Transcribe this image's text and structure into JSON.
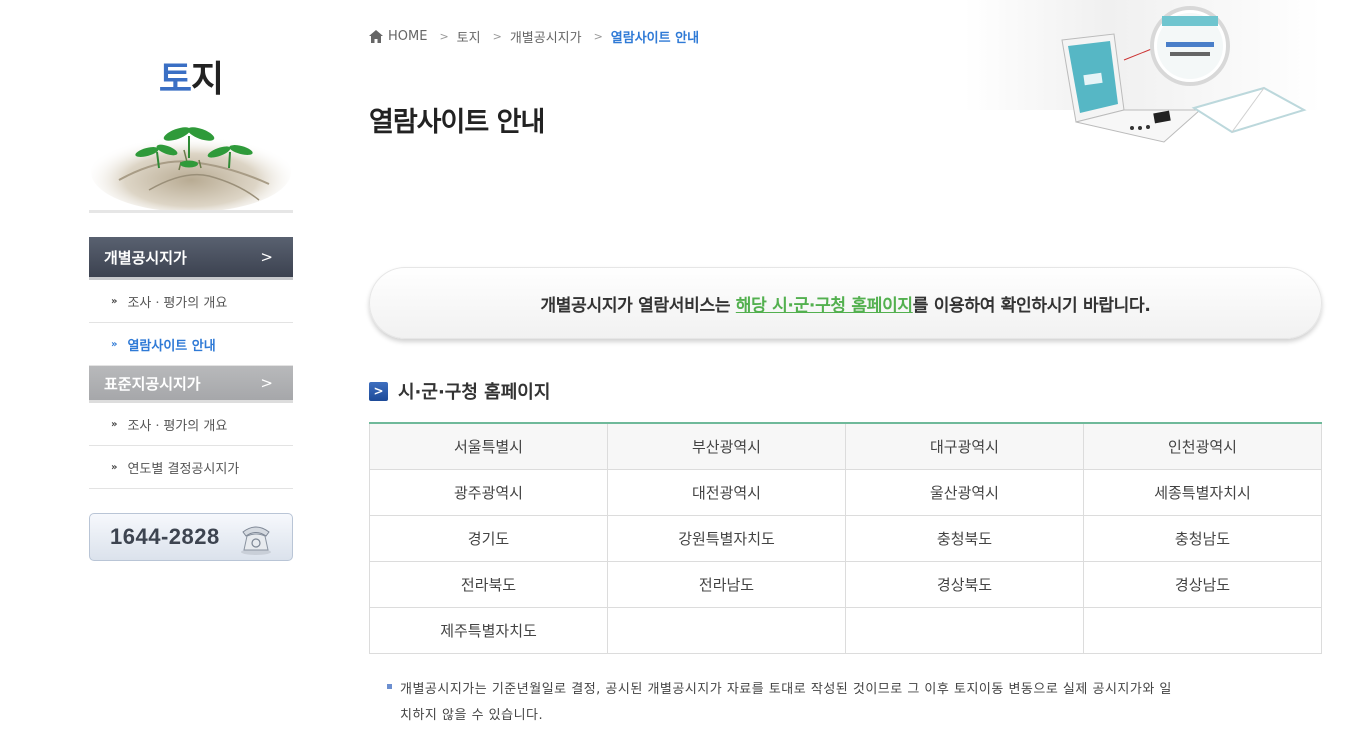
{
  "sidebar": {
    "title_accent": "토",
    "title_rest": "지",
    "menu": [
      {
        "label": "개별공시지가",
        "arrow": ">",
        "sub_items": [
          "조사ㆍ평가의 개요",
          "열람사이트 안내"
        ]
      },
      {
        "label": "표준지공시지가",
        "arrow": ">",
        "sub_items": [
          "조사ㆍ평가의 개요",
          "연도별 결정공시지가"
        ]
      }
    ],
    "sub_bullet": "»",
    "phone": "1644-2828"
  },
  "breadcrumb": {
    "home": "HOME",
    "items": [
      "토지",
      "개별공시지가",
      "열람사이트 안내"
    ],
    "sep": ">"
  },
  "page_title": "열람사이트 안내",
  "notice": {
    "before": "개별공시지가 열람서비스는 ",
    "highlight": "해당 시·군·구청 홈페이지",
    "after": "를 이용하여 확인하시기 바랍니다."
  },
  "section": {
    "icon": ">",
    "title": "시·군·구청 홈페이지"
  },
  "cities": [
    [
      "서울특별시",
      "부산광역시",
      "대구광역시",
      "인천광역시"
    ],
    [
      "광주광역시",
      "대전광역시",
      "울산광역시",
      "세종특별자치시"
    ],
    [
      "경기도",
      "강원특별자치도",
      "충청북도",
      "충청남도"
    ],
    [
      "전라북도",
      "전라남도",
      "경상북도",
      "경상남도"
    ],
    [
      "제주특별자치도",
      "",
      "",
      ""
    ]
  ],
  "footnote": {
    "line1": "개별공시지가는 기준년월일로 결정, 공시된 개별공시지가 자료를 토대로 작성된 것이므로 그 이후 토지이동 변동으로 실제 공시지가와 일",
    "line2": "치하지 않을 수 있습니다."
  },
  "colors": {
    "accent_blue": "#3a6fc4",
    "link_blue": "#2f7ad6",
    "highlight_green": "#53b04f",
    "table_top_border": "#6fb99a",
    "active_menu_bg": "#4a505e",
    "inactive_menu_bg": "#acadb0"
  }
}
